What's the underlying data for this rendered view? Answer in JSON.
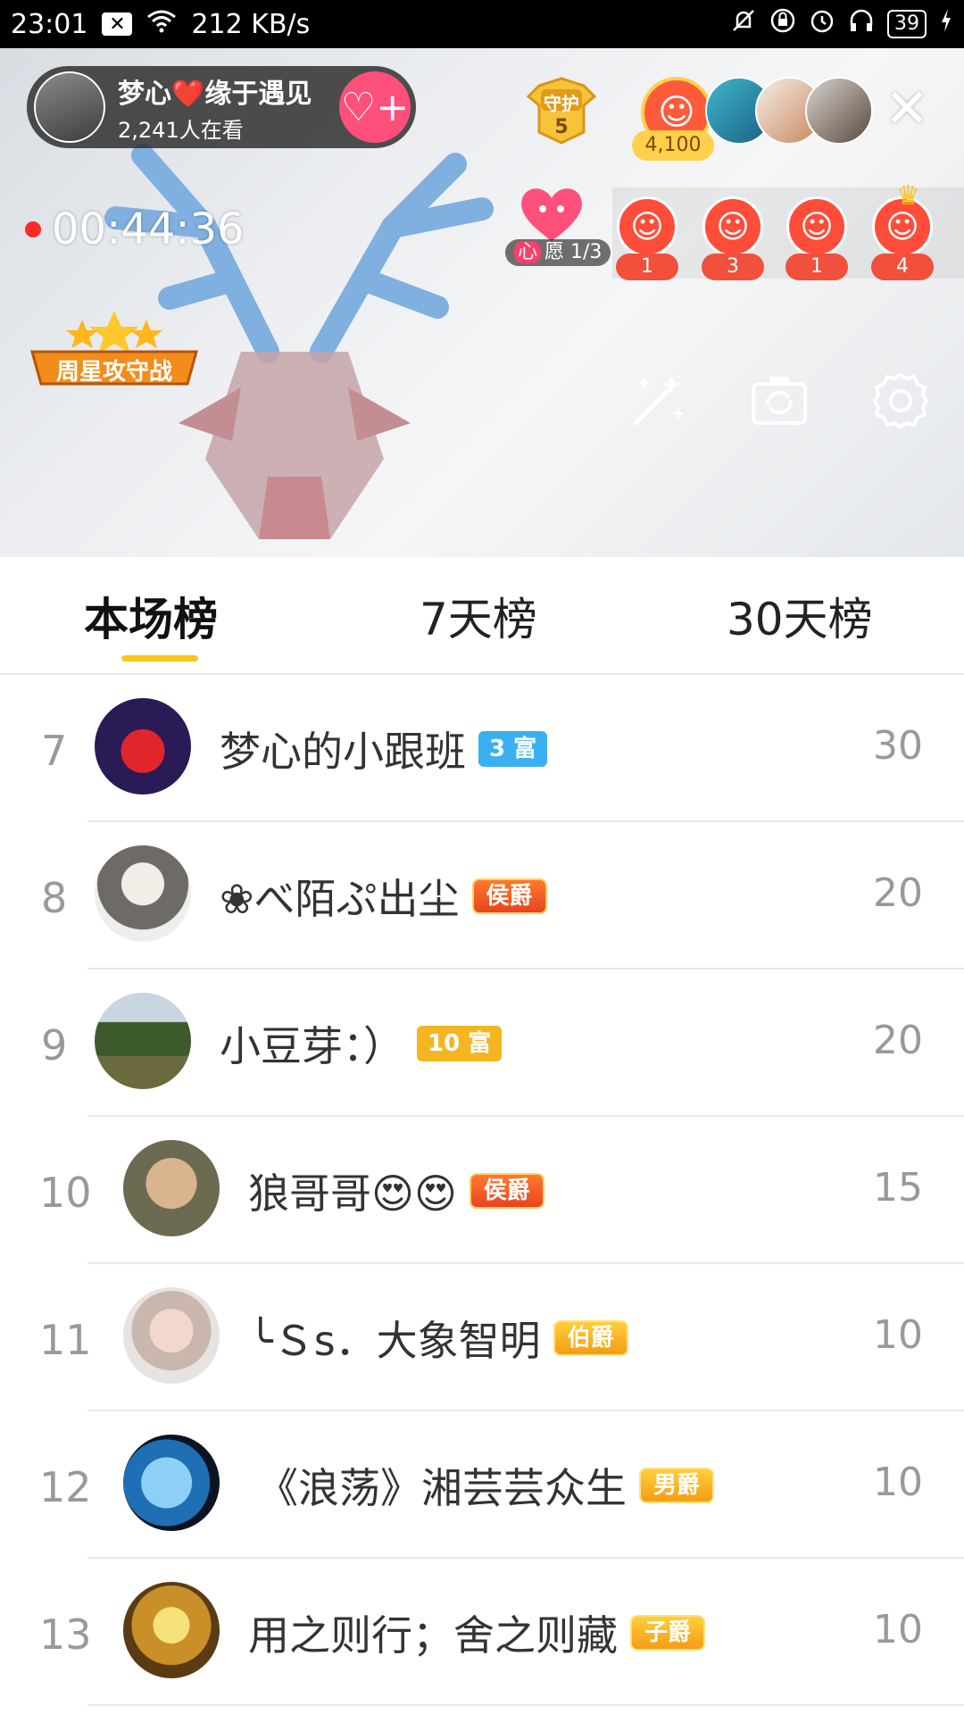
{
  "status_bar": {
    "time": "23:01",
    "net_speed": "212 KB/s",
    "battery": "39"
  },
  "live": {
    "host_name": "梦心❤️缘于遇见",
    "viewers": "2,241人在看",
    "follow_symbol": "♡+",
    "guard_label": "守护",
    "guard_count": "5",
    "top_fan_count": "4,100",
    "close_symbol": "✕",
    "timer": "00:44:36",
    "wish_label_prefix": "心",
    "wish_label_rest": "愿 1/3",
    "gifts": [
      {
        "count": "1"
      },
      {
        "count": "3"
      },
      {
        "count": "1"
      },
      {
        "count": "4"
      }
    ],
    "weekly_badge": "周星攻守战"
  },
  "tabs": [
    {
      "label": "本场榜"
    },
    {
      "label": "7天榜"
    },
    {
      "label": "30天榜"
    }
  ],
  "ranking": [
    {
      "rank": "7",
      "name": "梦心的小跟班",
      "badge": "3 富",
      "score": "30"
    },
    {
      "rank": "8",
      "name": "❀べ陌ぷ出尘",
      "badge": "侯爵",
      "score": "20"
    },
    {
      "rank": "9",
      "name": "小豆芽：）",
      "badge": "10 富",
      "score": "20"
    },
    {
      "rank": "10",
      "name": "狼哥哥😍😍",
      "badge": "侯爵",
      "score": "15"
    },
    {
      "rank": "11",
      "name": "╰Ｓs．大象智明",
      "badge": "伯爵",
      "score": "10"
    },
    {
      "rank": "12",
      "name": "《浪荡》湘芸芸众生",
      "badge": "男爵",
      "score": "10"
    },
    {
      "rank": "13",
      "name": "用之则行；舍之则藏",
      "badge": "子爵",
      "score": "10"
    }
  ]
}
